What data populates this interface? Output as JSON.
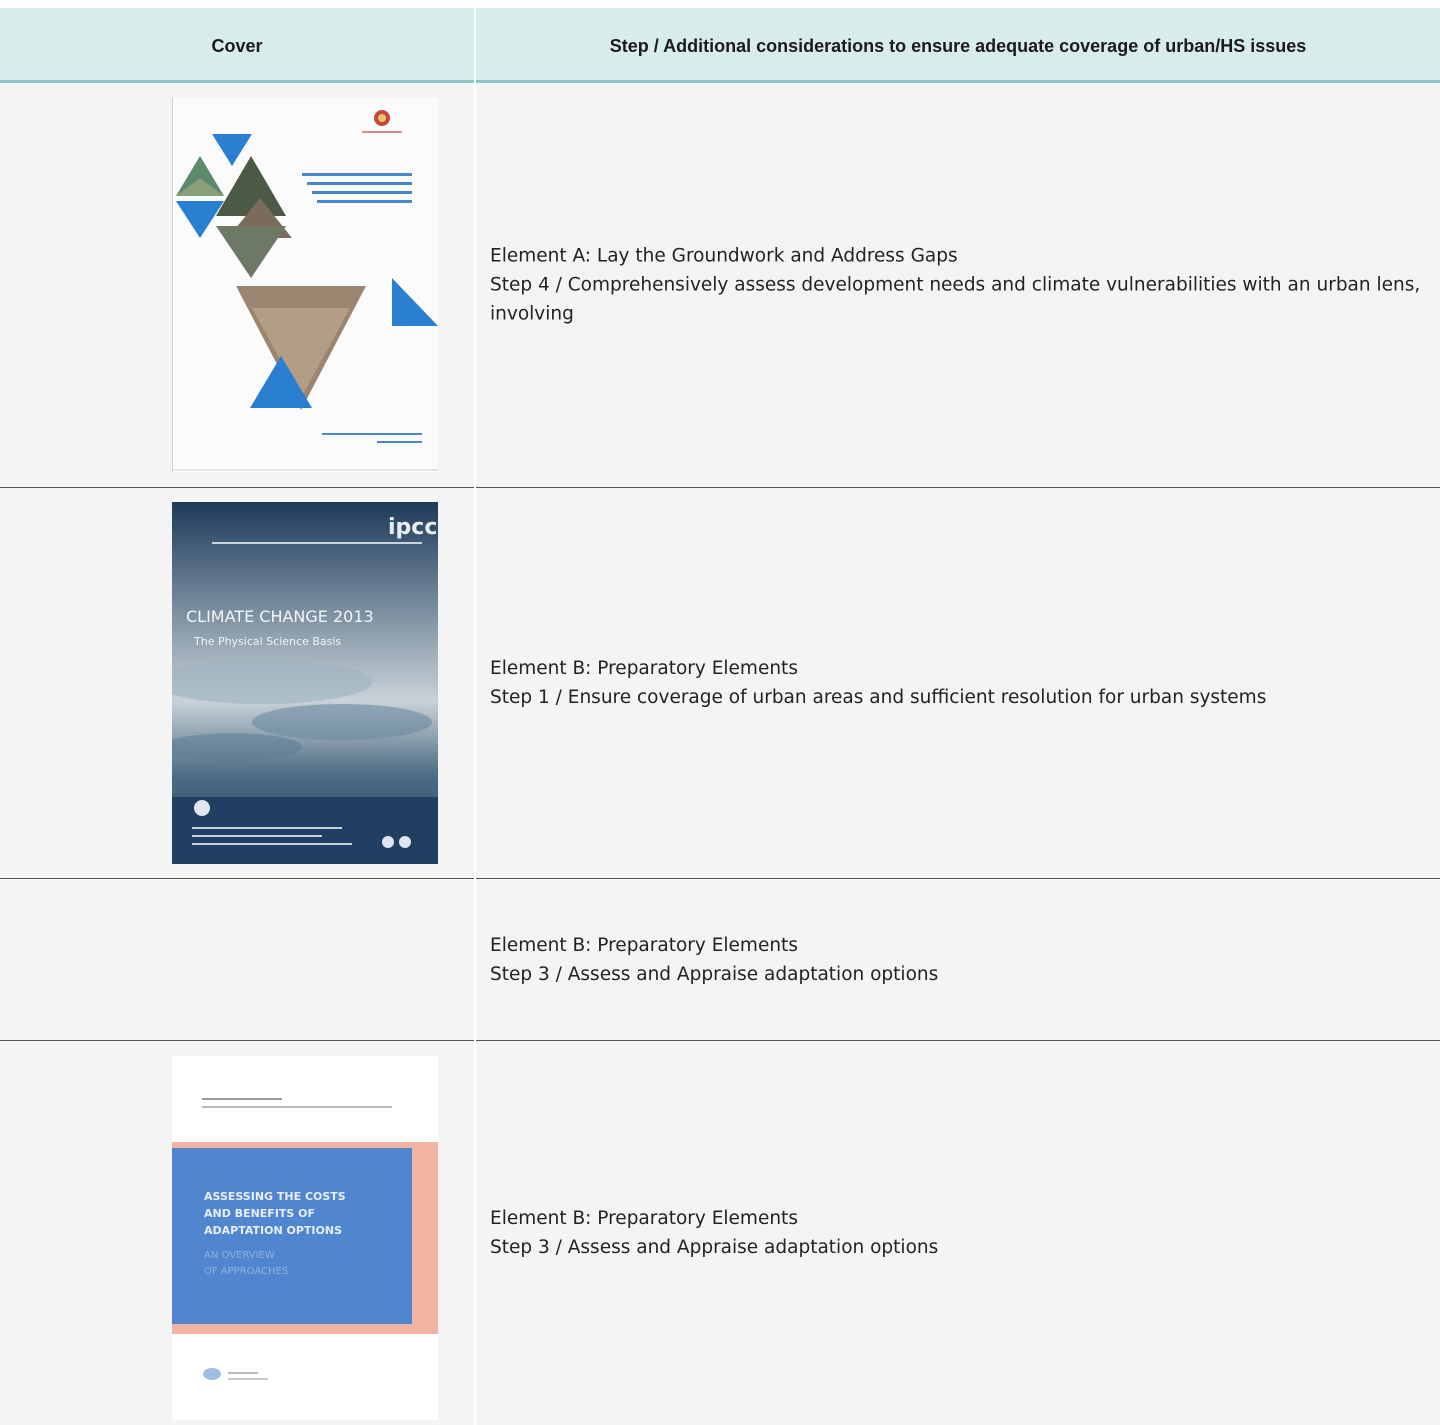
{
  "header": {
    "col_cover": "Cover",
    "col_step": "Step / Additional considerations to ensure adequate coverage of urban/HS issues"
  },
  "rows": [
    {
      "element": "Element A: Lay the Groundwork and Address Gaps",
      "step": "Step 4 / Comprehensively assess development needs and climate vulnerabilities with an urban lens, involving",
      "cover": {
        "theme": "white cover with blue triangles and landscape photo triangles"
      }
    },
    {
      "element": "Element B: Preparatory Elements",
      "step": "Step 1 / Ensure coverage of urban areas and sufficient resolution for urban systems",
      "cover": {
        "logo": "ipcc",
        "title": "CLIMATE CHANGE 2013",
        "subtitle": "The Physical Science Basis"
      }
    },
    {
      "element": "Element B: Preparatory Elements",
      "step": "Step 3 / Assess and Appraise adaptation options"
    },
    {
      "element": "Element B: Preparatory Elements",
      "step": "Step 3 / Assess and Appraise adaptation options",
      "cover": {
        "title_lines": [
          "ASSESSING THE COSTS",
          "AND BENEFITS OF",
          "ADAPTATION OPTIONS"
        ],
        "subtitle_lines": [
          "AN OVERVIEW",
          "OF APPROACHES"
        ]
      }
    }
  ],
  "colors": {
    "header_bg": "#d9ecec",
    "header_rule": "#8dc4c6",
    "cell_bg": "#f4f4f4",
    "blue": "#2a7fd0"
  }
}
